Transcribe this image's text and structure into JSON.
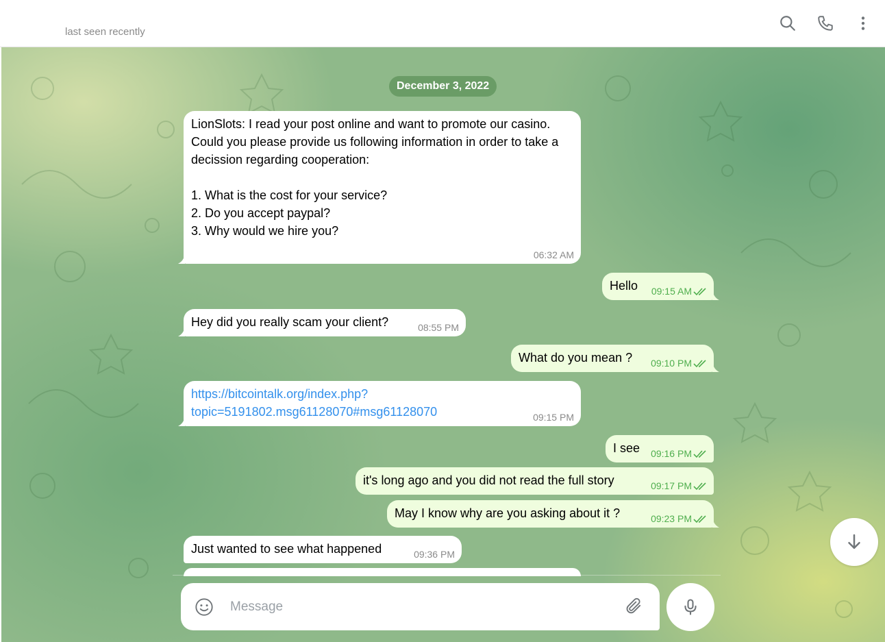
{
  "header": {
    "peer_name": "",
    "status": "last seen recently",
    "icons": [
      "search-icon",
      "phone-icon",
      "more-vertical-icon"
    ]
  },
  "chat": {
    "date": "December 3, 2022",
    "messages": [
      {
        "dir": "in",
        "text": "LionSlots: I read your post online and want to promote our casino. Could you please provide us following information in order to take a decission regarding cooperation:\n\n1. What is the cost for your service?\n2. Do you accept paypal?\n3. Why would we hire you?",
        "time": "06:32 AM"
      },
      {
        "dir": "out",
        "text": "Hello",
        "time": "09:15 AM"
      },
      {
        "dir": "in",
        "text": "Hey did you really scam your client?",
        "time": "08:55 PM"
      },
      {
        "dir": "out",
        "text": "What do you mean ?",
        "time": "09:10 PM"
      },
      {
        "dir": "in",
        "text": "https://bitcointalk.org/index.php?\ntopic=5191802.msg61128070#msg61128070",
        "time": "09:15 PM",
        "is_link": true
      },
      {
        "dir": "out",
        "text": "I see",
        "time": "09:16 PM"
      },
      {
        "dir": "out",
        "text": "it's long ago and you did not read the full story",
        "time": "09:17 PM"
      },
      {
        "dir": "out",
        "text": "May I know why are you asking about it ?",
        "time": "09:23 PM"
      },
      {
        "dir": "in",
        "text": "Just wanted to see what happened",
        "time": "09:36 PM"
      }
    ]
  },
  "composer": {
    "placeholder": "Message",
    "icons": [
      "emoji-icon",
      "attach-icon",
      "mic-icon"
    ]
  },
  "colors": {
    "incoming_bubble": "#ffffff",
    "outgoing_bubble": "#effdde",
    "outgoing_time": "#4fae4e",
    "link": "#3390ec"
  }
}
